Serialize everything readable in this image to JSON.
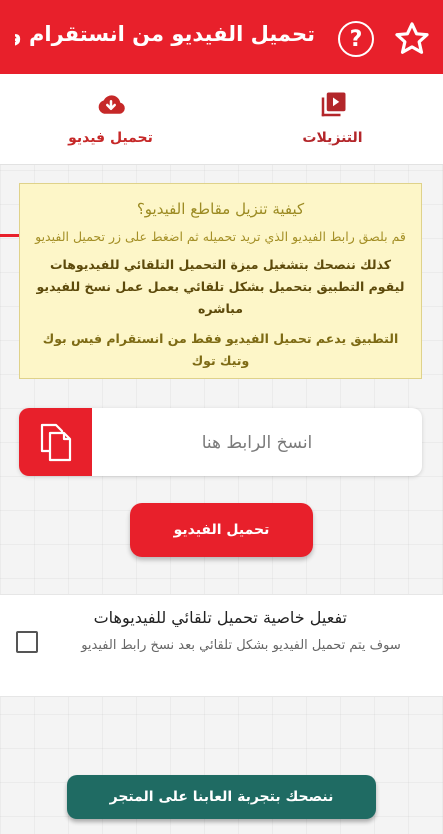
{
  "header": {
    "title": "تحميل الفيديو من انستقرام و ف...",
    "help_symbol": "?",
    "star_icon": "star-outline-icon",
    "background_color": "#e8202b"
  },
  "tabs": [
    {
      "label": "تحميل  فيديو",
      "icon": "cloud-download-icon",
      "active": true
    },
    {
      "label": "التنزيلات",
      "icon": "video-library-icon",
      "active": false
    }
  ],
  "info": {
    "question": "كيفية تنزيل مقاطع الفيديو؟",
    "paragraph1": "قم بلصق رابط الفيديو الذي تريد تحميله ثم اضغط على زر تحميل الفيديو",
    "paragraph2": "كذلك ننصحك بتشغيل ميزة التحميل التلقائي للفيديوهات ليقوم التطبيق بتحميل بشكل تلقائي بعمل عمل نسخ للفيديو مباشره",
    "paragraph3": "التطبيق يدعم تحميل الفيديو فقط من انستقرام فيس بوك وتيك توك"
  },
  "url_input": {
    "placeholder": "انسخ الرابط هنا",
    "value": "",
    "paste_icon": "paste-icon"
  },
  "download_button": "تحميل الفيديو",
  "auto_download": {
    "title": "تفعيل خاصية تحميل تلقائي للفيديوهات",
    "description": "سوف يتم تحميل الفيديو بشكل تلقائي بعد نسخ رابط الفيديو",
    "checked": false
  },
  "store_button": "ننصحك بتجربة العابنا على المتجر",
  "colors": {
    "accent": "#e8202b",
    "store_button": "#1f6b63",
    "info_bg": "#fdf6c8"
  }
}
